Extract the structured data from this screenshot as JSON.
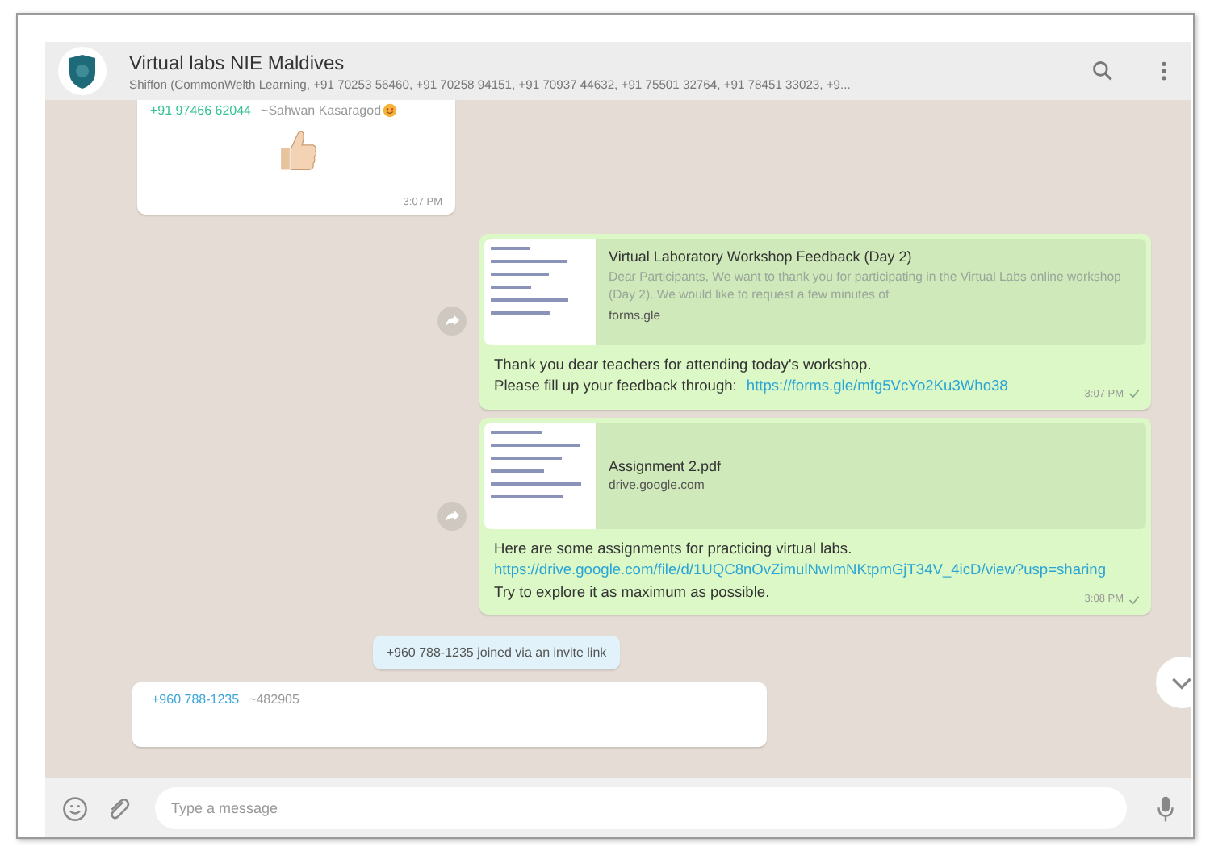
{
  "chat": {
    "title": "Virtual labs NIE Maldives",
    "members": "Shiffon (CommonWelth Learning, +91 70253 56460, +91 70258 94151, +91 70937 44632, +91 75501 32764, +91 78451 33023, +9..."
  },
  "messages": [
    {
      "kind": "sticker",
      "sender": "+91 97466 62044",
      "sender_name": "~Sahwan Kasaragod",
      "time": "3:07 PM"
    },
    {
      "kind": "outgoing",
      "forward_button": true,
      "preview": {
        "title": "Virtual Laboratory Workshop Feedback (Day 2)",
        "description": "Dear Participants, We want to thank you for participating in the Virtual Labs online workshop (Day 2). We would like to request a few minutes of",
        "domain": "forms.gle"
      },
      "lines": [
        [
          {
            "kind": "text",
            "text": "Thank you  dear teachers for attending today's workshop."
          }
        ],
        [
          {
            "kind": "text",
            "text": "Please fill up your feedback through:"
          },
          {
            "kind": "link",
            "text": "https://forms.gle/mfg5VcYo2Ku3Who38"
          }
        ]
      ],
      "time": "3:07 PM"
    },
    {
      "kind": "outgoing",
      "forward_button": true,
      "preview": {
        "title": "Assignment 2.pdf",
        "domain": "drive.google.com"
      },
      "lines": [
        [
          {
            "kind": "text",
            "text": "Here are some assignments for practicing virtual labs."
          }
        ],
        [
          {
            "kind": "link",
            "text": "https://drive.google.com/file/d/1UQC8nOvZimulNwImNKtpmGjT34V_4icD/view?usp=sharing"
          }
        ],
        [
          {
            "kind": "text",
            "text": "Try to explore it as maximum as possible."
          }
        ]
      ],
      "time": "3:08 PM"
    },
    {
      "kind": "system",
      "text": "+960 788-1235 joined via an invite link"
    },
    {
      "kind": "incoming",
      "sender": "+960 788-1235",
      "sender_name": "~482905"
    }
  ],
  "composer": {
    "placeholder": "Type a message"
  }
}
